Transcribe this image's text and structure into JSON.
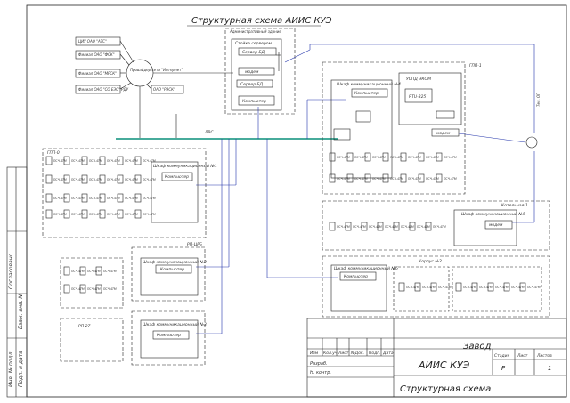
{
  "title": "Структурная схема АИИС КУЭ",
  "admin_building": {
    "label": "Административный здание",
    "rack_label": "Стойка сервером",
    "server_label": "Сервер БД",
    "modem_label": "модем",
    "computer_label": "Компьютер",
    "tags": [
      "A1",
      "A1.2",
      "A1.1"
    ]
  },
  "external_systems": {
    "ciu": "ЦИУ ОАО \"АТС\"",
    "fsk": "Филиал ОАО \"ФСК\"",
    "mrsk": "Филиал ОАО \"МРСК\"",
    "so": "Филиал ОАО \"СО ЕЭС\" РДУ",
    "provider": "Провайдер сети \"Интернет\"",
    "rdu": "ОАО \"РЭСК\""
  },
  "network": {
    "bus_label": "ЛВС",
    "internet_label": "Интернет",
    "lvs_ru": "ЛВС",
    "tel_line": "Тел. ОП"
  },
  "cabinets": [
    {
      "name": "Шкаф коммуникационный №1",
      "substation": "ГПП-0",
      "computer": "Компьютер",
      "tag": "A4"
    },
    {
      "name": "Шкаф коммуникационный №2",
      "substation": "РП-ЦРБ",
      "computer": "Компьютер",
      "tag": "A5"
    },
    {
      "name": "Шкаф коммуникационный №3",
      "substation": "РП-27",
      "computer": "Компьютер",
      "tag": "A6"
    },
    {
      "name": "Шкаф коммуникационный №4",
      "substation": "ГПП-1",
      "computer": "Компьютер",
      "tag": "A3"
    },
    {
      "name": "Шкаф коммуникационный №5",
      "substation": "Котельная-1",
      "computer": "модем",
      "tag": "A7"
    },
    {
      "name": "Шкаф коммуникационный №6",
      "substation": "Корпус №2",
      "computer": "Компьютер",
      "tag": "A8"
    }
  ],
  "uspd": {
    "label": "УСПД ЭКОМ",
    "model": "ЭКОМ-3000",
    "rtu": "RTU-325"
  },
  "meters_label": "ПСЧ-4ТМ",
  "title_block": {
    "company": "Завод",
    "system": "АИИС КУЭ",
    "document": "Структурная схема",
    "stage_label": "Стадия",
    "sheet_label": "Лист",
    "sheets_label": "Листов",
    "stage": "Р",
    "sheets": "1",
    "columns": [
      "Изм",
      "Кол.уч",
      "Лист",
      "№Док.",
      "Подп.",
      "Дата"
    ],
    "rows": [
      "Разраб.",
      "Н. контр."
    ]
  },
  "side_stamp": [
    "Инв. № подл.",
    "Подп. и дата",
    "Взам. инв. №",
    "Согласовано"
  ]
}
